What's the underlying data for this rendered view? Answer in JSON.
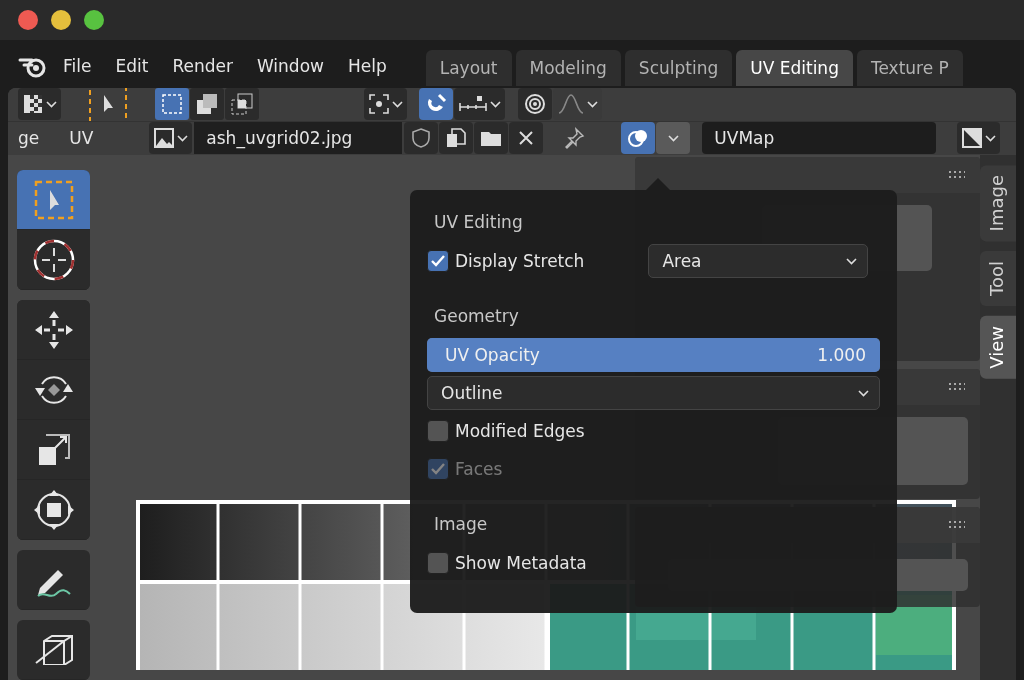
{
  "menu": [
    "File",
    "Edit",
    "Render",
    "Window",
    "Help"
  ],
  "workspace_tabs": [
    {
      "label": "Layout",
      "selected": false
    },
    {
      "label": "Modeling",
      "selected": false
    },
    {
      "label": "Sculpting",
      "selected": false
    },
    {
      "label": "UV Editing",
      "selected": true
    },
    {
      "label": "Texture P",
      "selected": false
    }
  ],
  "tool_header": {
    "select_modes": [
      {
        "kind": "extend",
        "selected": true
      },
      {
        "kind": "subtract",
        "selected": false
      },
      {
        "kind": "intersect",
        "selected": false
      }
    ],
    "snap": {
      "on": true
    },
    "proportional_edit": {
      "on": false
    }
  },
  "editor_header": {
    "menus": [
      "ge",
      "UV"
    ],
    "image_name": "ash_uvgrid02.jpg",
    "overlays": {
      "on": true
    },
    "uv_map": "UVMap"
  },
  "toolbar": {
    "groups": [
      [
        {
          "kind": "select",
          "selected": true
        },
        {
          "kind": "cursor",
          "selected": false
        }
      ],
      [
        {
          "kind": "move",
          "selected": false
        },
        {
          "kind": "rotate",
          "selected": false
        },
        {
          "kind": "scale",
          "selected": false
        },
        {
          "kind": "transform",
          "selected": false
        }
      ],
      [
        {
          "kind": "annotate",
          "selected": false
        }
      ],
      [
        {
          "kind": "cube",
          "selected": false
        }
      ]
    ]
  },
  "sidebar_tabs": [
    {
      "label": "Image",
      "selected": false
    },
    {
      "label": "Tool",
      "selected": false
    },
    {
      "label": "View",
      "selected": true
    }
  ],
  "overlay_popup": {
    "sections": [
      {
        "title": "UV Editing",
        "items": [
          {
            "kind": "checkbox",
            "label": "Display Stretch",
            "checked": true,
            "disabled": false,
            "option": "Area"
          }
        ]
      },
      {
        "title": "Geometry",
        "items": [
          {
            "kind": "slider",
            "label": "UV Opacity",
            "value": "1.000",
            "level": 1
          },
          {
            "kind": "dropdown",
            "value": "Outline"
          },
          {
            "kind": "checkbox",
            "label": "Modified Edges",
            "checked": false,
            "disabled": false
          },
          {
            "kind": "checkbox",
            "label": "Faces",
            "checked": true,
            "disabled": true
          }
        ]
      },
      {
        "title": "Image",
        "items": [
          {
            "kind": "checkbox",
            "label": "Show Metadata",
            "checked": false,
            "disabled": false
          }
        ]
      }
    ]
  }
}
